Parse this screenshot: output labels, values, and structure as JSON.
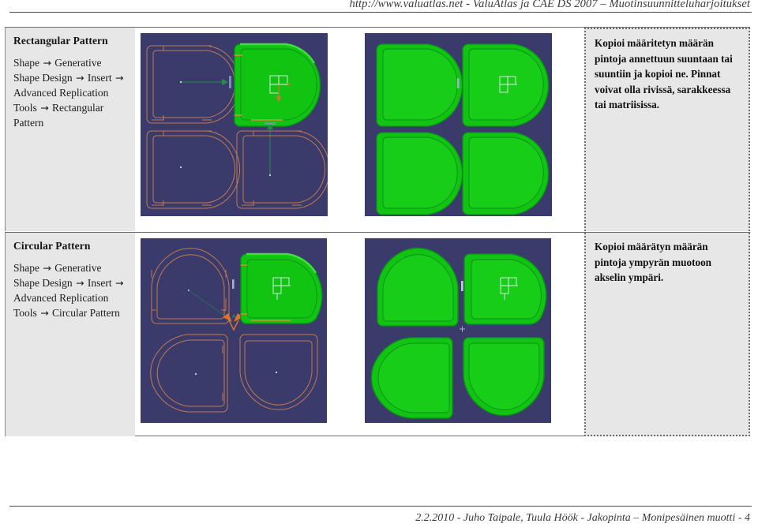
{
  "header": {
    "text": "http://www.valuatlas.net - ValuAtlas ja CAE DS 2007 – Muotinsuunnitteluharjoitukset"
  },
  "footer": {
    "text": "2.2.2010 - Juho Taipale, Tuula Höök - Jakopinta – Monipesäinen muotti - 4"
  },
  "rows": [
    {
      "title": "Rectangular Pattern",
      "path_lines": [
        "Shape → Generative",
        "Shape Design → Insert →",
        "Advanced Replication",
        "Tools → Rectangular",
        "Pattern"
      ],
      "description": "Kopioi määritetyn määrän pintoja annettuun suuntaan tai suuntiin ja kopioi ne. Pinnat voivat olla rivissä, sarakkeessa tai matriisissa.",
      "image_left_alt": "CAD viewport: four D-shaped parting-surface instances in a 2x2 rectangular grid, top-right instance shaded green, the other three shown as orange wireframe outlines, with green direction arrows from the centre point",
      "image_right_alt": "CAD viewport: all four D-shaped parting surfaces shaded green in a 2x2 rectangular array"
    },
    {
      "title": "Circular Pattern",
      "path_lines": [
        "Shape → Generative",
        "Shape Design → Insert →",
        "Advanced Replication",
        "Tools → Circular Pattern"
      ],
      "description": "Kopioi määrätyn määrän pintoja ympyrän muotoon akselin ympäri.",
      "image_left_alt": "CAD viewport: four D-shaped parting surfaces rotated around a central axis, top-right instance shaded green, the other three shown as orange wireframe outlines with an angular dimension arrow at the centre",
      "image_right_alt": "CAD viewport: all four D-shaped parting surfaces shaded green, rotated around a central axis in a circular pattern"
    }
  ],
  "colors": {
    "panel_bg": "#e7e7e7",
    "viewport_bg": "#3b3b6b",
    "surface_green": "#12c412",
    "surface_green_dark": "#0d8f1e",
    "wireframe_orange": "#c27a52",
    "rule": "#4a4a4a",
    "dotted_border": "#6e6e6e"
  }
}
